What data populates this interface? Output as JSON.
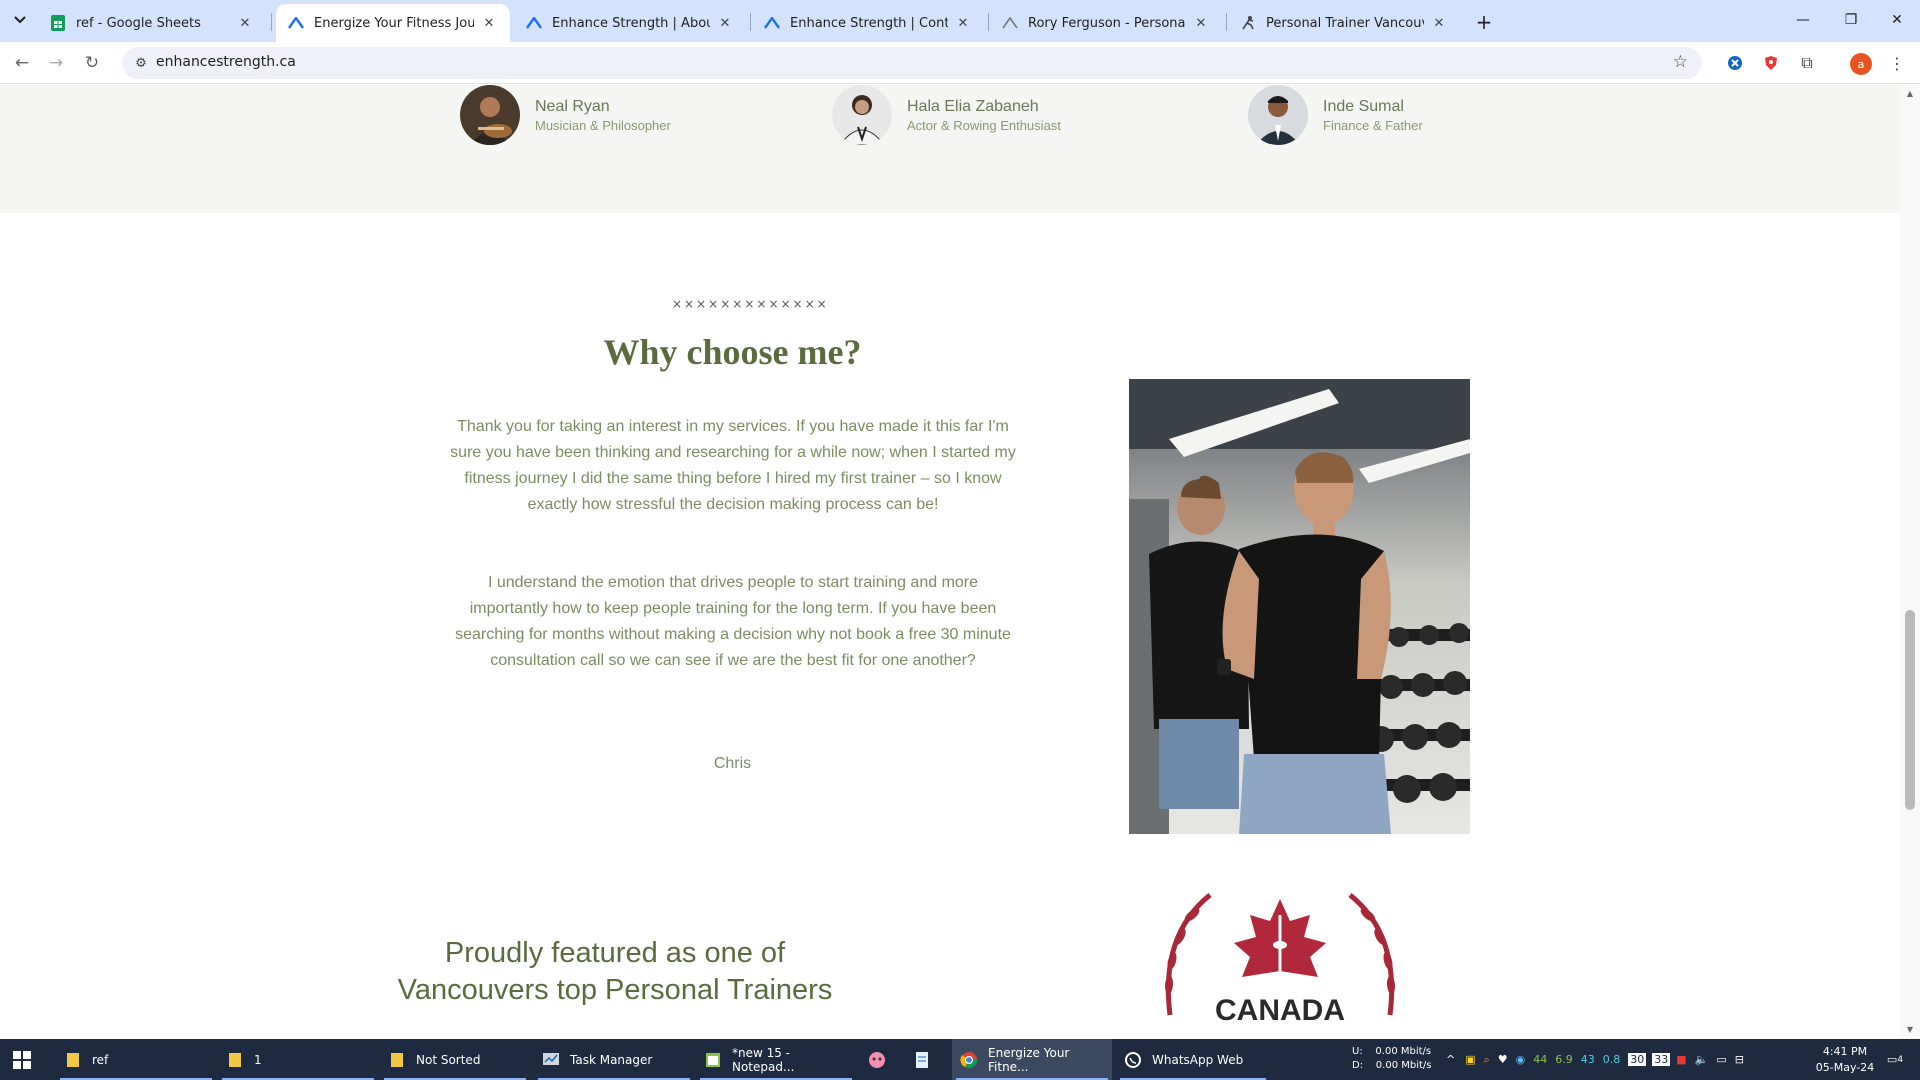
{
  "browser": {
    "tabs": [
      {
        "title": "ref - Google Sheets",
        "icon": "google-sheets-icon",
        "active": false
      },
      {
        "title": "Energize Your Fitness Journey w",
        "icon": "enhance-strength-icon",
        "active": true
      },
      {
        "title": "Enhance Strength | About",
        "icon": "enhance-strength-icon",
        "active": false
      },
      {
        "title": "Enhance Strength | Contact",
        "icon": "enhance-strength-icon",
        "active": false
      },
      {
        "title": "Rory Ferguson - Personal Trainin",
        "icon": "site-icon",
        "active": false
      },
      {
        "title": "Personal Trainer Vancouver | We",
        "icon": "trainer-icon",
        "active": false
      }
    ],
    "url": "enhancestrength.ca",
    "profile_initial": "a"
  },
  "testimonials": [
    {
      "name": "Neal Ryan",
      "role": "Musician & Philosopher"
    },
    {
      "name": "Hala Elia Zabaneh",
      "role": "Actor & Rowing Enthusiast"
    },
    {
      "name": "Inde Sumal",
      "role": "Finance & Father"
    }
  ],
  "why": {
    "stars": "×××××××××××××",
    "title": "Why choose me?",
    "paragraph1": "Thank you for taking an interest in my services. If you have made it this far I'm sure you have been thinking and researching for a while now; when I started my fitness journey I did the same thing before I hired my first trainer – so I know exactly how stressful the decision making process can be!",
    "paragraph2": "I understand the emotion that drives people to start training and more importantly how to keep people training for the long term. If you have been searching for months without making a decision why not book a free 30 minute consultation call so we can see if we are the best fit for one another?",
    "signature": "Chris"
  },
  "featured": {
    "line1": "Proudly featured as one of",
    "line2": "Vancouvers top Personal Trainers",
    "badge_text": "CANADA"
  },
  "taskbar": {
    "items": [
      {
        "label": "ref",
        "icon": "folder-icon"
      },
      {
        "label": "1",
        "icon": "folder-icon"
      },
      {
        "label": "Not Sorted",
        "icon": "folder-icon"
      },
      {
        "label": "Task Manager",
        "icon": "task-manager-icon"
      },
      {
        "label": "*new 15 - Notepad...",
        "icon": "notepad-icon"
      },
      {
        "label": "Energize Your Fitne...",
        "icon": "chrome-icon"
      },
      {
        "label": "WhatsApp Web",
        "icon": "whatsapp-icon"
      }
    ],
    "network": {
      "up_label": "U:",
      "up": "0.00 Mbit/s",
      "down_label": "D:",
      "down": "0.00 Mbit/s"
    },
    "tray_values": [
      "44",
      "6.9",
      "43",
      "0.8",
      "30",
      "33"
    ],
    "time": "4:41 PM",
    "date": "05-May-24",
    "notifications": "4"
  },
  "colors": {
    "accent_green": "#5b6b3e",
    "text_green": "#7d8c63",
    "tab_bar": "#d3e3fd",
    "taskbar": "#1e2a3f"
  }
}
